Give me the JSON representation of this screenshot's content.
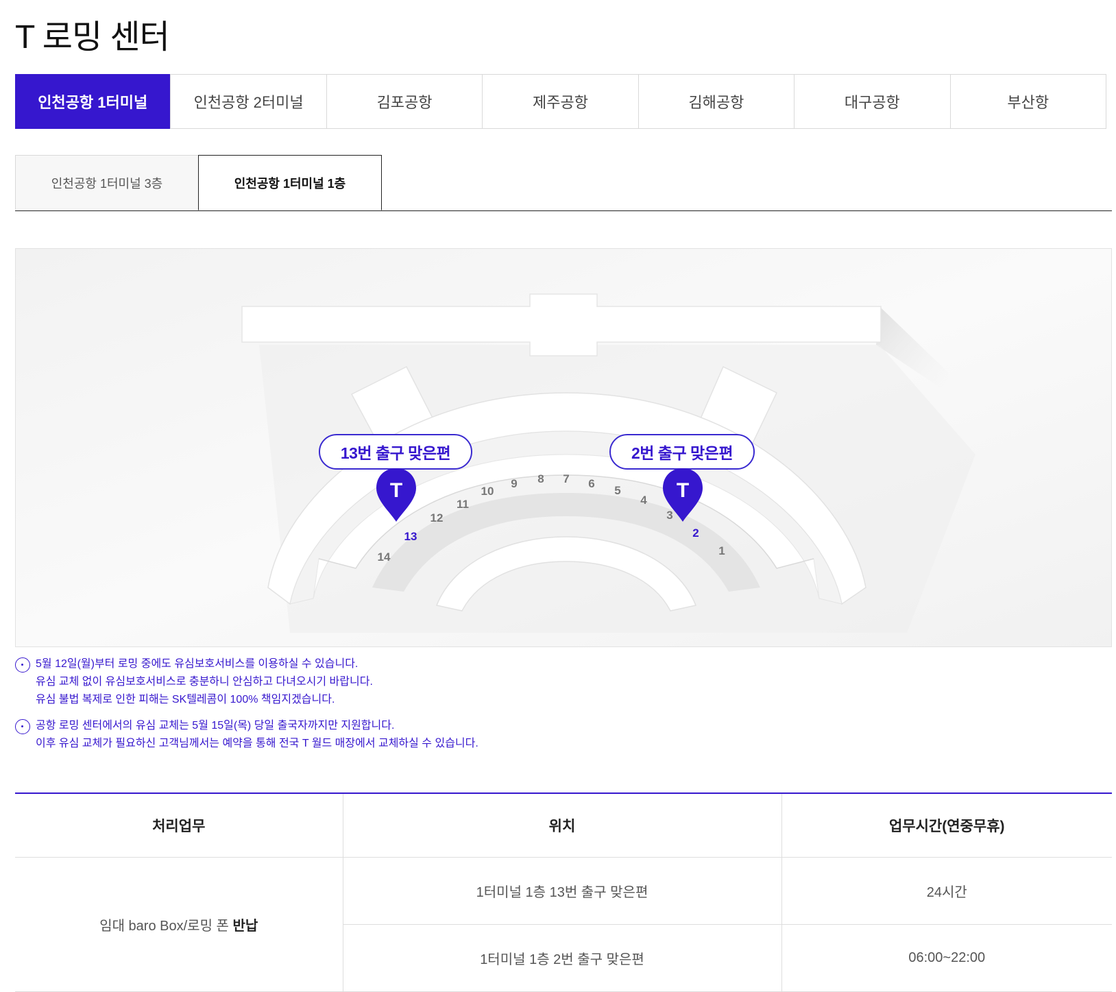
{
  "page": {
    "title": "T 로밍 센터"
  },
  "airport_tabs": [
    {
      "label": "인천공항 1터미널",
      "active": true
    },
    {
      "label": "인천공항 2터미널",
      "active": false
    },
    {
      "label": "김포공항",
      "active": false
    },
    {
      "label": "제주공항",
      "active": false
    },
    {
      "label": "김해공항",
      "active": false
    },
    {
      "label": "대구공항",
      "active": false
    },
    {
      "label": "부산항",
      "active": false
    }
  ],
  "floor_tabs": [
    {
      "label": "인천공항 1터미널 3층",
      "active": false
    },
    {
      "label": "인천공항 1터미널 1층",
      "active": true
    }
  ],
  "map": {
    "locations": [
      {
        "label": "13번 출구 맞은편",
        "gate": "13"
      },
      {
        "label": "2번 출구 맞은편",
        "gate": "2"
      }
    ],
    "gates": [
      "14",
      "13",
      "12",
      "11",
      "10",
      "9",
      "8",
      "7",
      "6",
      "5",
      "4",
      "3",
      "2",
      "1"
    ],
    "pin_letter": "T",
    "highlight_color": "#3617ce"
  },
  "notices": [
    {
      "lines": [
        "5월 12일(월)부터 로밍 중에도 유심보호서비스를 이용하실 수 있습니다.",
        "유심 교체 없이 유심보호서비스로 충분하니 안심하고 다녀오시기 바랍니다.",
        "유심 불법 복제로 인한 피해는 SK텔레콤이 100% 책임지겠습니다."
      ]
    },
    {
      "lines": [
        "공항 로밍 센터에서의 유심 교체는 5월 15일(목) 당일 출국자까지만 지원합니다.",
        "이후 유심 교체가 필요하신 고객님께서는 예약을 통해 전국 T 월드 매장에서 교체하실 수 있습니다."
      ]
    }
  ],
  "table": {
    "headers": [
      "처리업무",
      "위치",
      "업무시간(연중무휴)"
    ],
    "task_prefix": "임대 baro Box/로밍 폰 ",
    "task_bold": "반납",
    "rows": [
      {
        "location": "1터미널 1층 13번 출구 맞은편",
        "hours": "24시간"
      },
      {
        "location": "1터미널 1층 2번 출구 맞은편",
        "hours": "06:00~22:00"
      }
    ]
  }
}
